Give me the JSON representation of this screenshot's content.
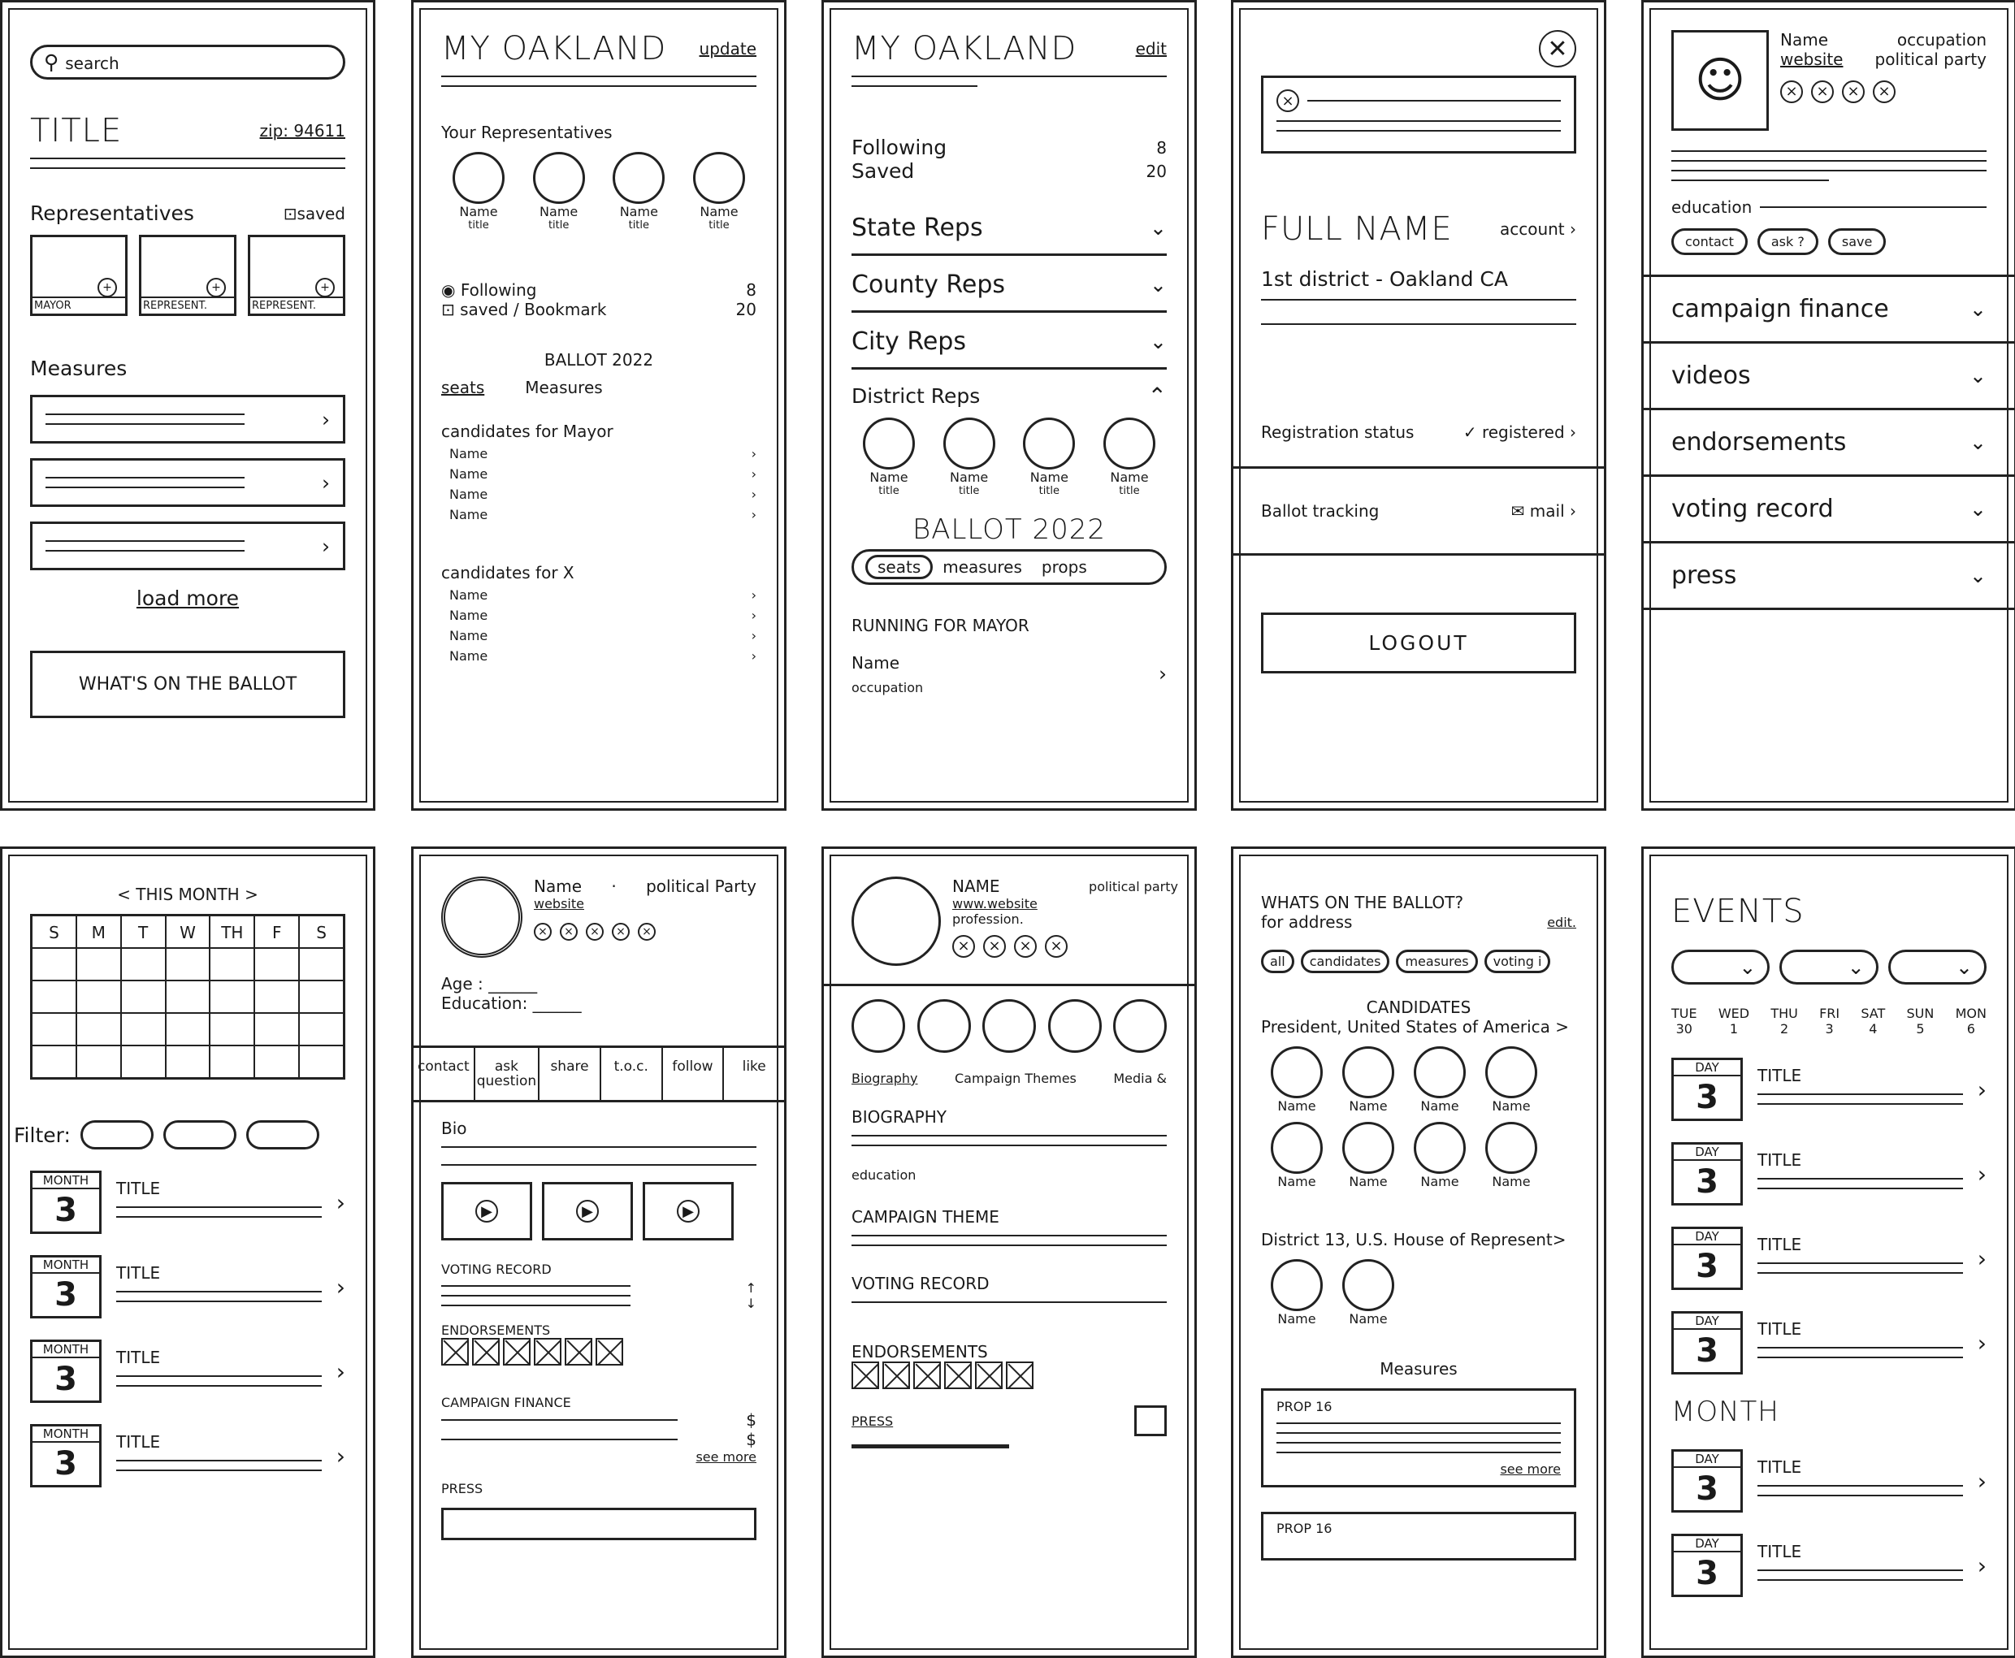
{
  "home": {
    "search_placeholder": "search",
    "title": "TITLE",
    "zip": "zip: 94611",
    "reps_heading": "Representatives",
    "saved": "saved",
    "rep_cards": [
      "MAYOR",
      "REPRESENT.",
      "REPRESENT."
    ],
    "measures_heading": "Measures",
    "load_more": "load more",
    "ballot_button": "WHAT'S ON THE BALLOT"
  },
  "my_oakland_a": {
    "title": "MY OAKLAND",
    "update": "update",
    "your_reps": "Your Representatives",
    "reps": [
      {
        "name": "Name",
        "title": "title"
      },
      {
        "name": "Name",
        "title": "title"
      },
      {
        "name": "Name",
        "title": "title"
      },
      {
        "name": "Name",
        "title": "title"
      }
    ],
    "following": "Following",
    "following_count": "8",
    "saved": "saved / Bookmark",
    "saved_count": "20",
    "ballot": "BALLOT 2022",
    "tabs": [
      "seats",
      "Measures"
    ],
    "groups": [
      {
        "heading": "candidates for Mayor",
        "names": [
          "Name",
          "Name",
          "Name",
          "Name"
        ]
      },
      {
        "heading": "candidates for X",
        "names": [
          "Name",
          "Name",
          "Name",
          "Name"
        ]
      }
    ]
  },
  "my_oakland_b": {
    "title": "MY OAKLAND",
    "edit": "edit",
    "following": "Following",
    "following_count": "8",
    "saved": "Saved",
    "saved_count": "20",
    "sections": [
      "State Reps",
      "County Reps",
      "City Reps"
    ],
    "district": "District Reps",
    "reps": [
      {
        "name": "Name",
        "title": "title"
      },
      {
        "name": "Name",
        "title": "title"
      },
      {
        "name": "Name",
        "title": "title"
      },
      {
        "name": "Name",
        "title": "title"
      }
    ],
    "ballot": "BALLOT 2022",
    "segments": [
      "seats",
      "measures",
      "props"
    ],
    "running": "RUNNING FOR MAYOR",
    "candidate_name": "Name",
    "candidate_occupation": "occupation"
  },
  "account": {
    "full_name": "FULL NAME",
    "account": "account",
    "district": "1st district - Oakland CA",
    "registration": "Registration status",
    "registered": "✓ registered",
    "ballot_tracking": "Ballot tracking",
    "mail": "mail",
    "logout": "LOGOUT"
  },
  "profile_a": {
    "name": "Name",
    "occupation": "occupation",
    "website": "website",
    "party": "political party",
    "education": "education",
    "buttons": [
      "contact",
      "ask ?",
      "save"
    ],
    "sections": [
      "campaign finance",
      "videos",
      "endorsements",
      "voting record",
      "press"
    ]
  },
  "calendar": {
    "month": "< THIS MONTH >",
    "days": [
      "S",
      "M",
      "T",
      "W",
      "TH",
      "F",
      "S"
    ],
    "filter": "Filter:",
    "events": [
      {
        "month": "MONTH",
        "day": "3",
        "title": "TITLE"
      },
      {
        "month": "MONTH",
        "day": "3",
        "title": "TITLE"
      },
      {
        "month": "MONTH",
        "day": "3",
        "title": "TITLE"
      },
      {
        "month": "MONTH",
        "day": "3",
        "title": "TITLE"
      }
    ]
  },
  "profile_b": {
    "name": "Name",
    "dot": "·",
    "party": "political Party",
    "website": "website",
    "age": "Age :",
    "education": "Education:",
    "actions": [
      "contact",
      "ask question",
      "share",
      "t.o.c.",
      "follow",
      "like"
    ],
    "bio": "Bio",
    "voting_record": "VOTING RECORD",
    "endorsements": "ENDORSEMENTS",
    "campaign_finance": "CAMPAIGN FINANCE",
    "dollar": "$",
    "see_more": "see more",
    "press": "PRESS"
  },
  "profile_c": {
    "name": "NAME",
    "website": "www.website",
    "profession": "profession.",
    "party": "political party",
    "tabs": [
      "Biography",
      "Campaign Themes",
      "Media &"
    ],
    "biography": "BIOGRAPHY",
    "education": "education",
    "campaign_theme": "CAMPAIGN THEME",
    "voting_record": "VOTING RECORD",
    "endorsements": "ENDORSEMENTS",
    "press": "PRESS"
  },
  "ballot": {
    "title": "WHATS ON THE BALLOT?",
    "for_address": "for address",
    "edit": "edit.",
    "chips": [
      "all",
      "candidates",
      "measures",
      "voting i"
    ],
    "candidates": "CANDIDATES",
    "race1": "President, United States of America >",
    "race1_names": [
      "Name",
      "Name",
      "Name",
      "Name",
      "Name",
      "Name",
      "Name",
      "Name"
    ],
    "race2": "District 13, U.S. House of Represent>",
    "race2_names": [
      "Name",
      "Name"
    ],
    "measures": "Measures",
    "props": [
      {
        "label": "PROP 16",
        "see_more": "see more"
      },
      {
        "label": "PROP 16"
      }
    ]
  },
  "events": {
    "title": "EVENTS",
    "week": [
      {
        "day": "TUE",
        "date": "30"
      },
      {
        "day": "WED",
        "date": "1"
      },
      {
        "day": "THU",
        "date": "2"
      },
      {
        "day": "FRI",
        "date": "3"
      },
      {
        "day": "SAT",
        "date": "4"
      },
      {
        "day": "SUN",
        "date": "5"
      },
      {
        "day": "MON",
        "date": "6"
      }
    ],
    "items": [
      {
        "label": "DAY",
        "day": "3",
        "title": "TITLE"
      },
      {
        "label": "DAY",
        "day": "3",
        "title": "TITLE"
      },
      {
        "label": "DAY",
        "day": "3",
        "title": "TITLE"
      },
      {
        "label": "DAY",
        "day": "3",
        "title": "TITLE"
      }
    ],
    "month": "MONTH",
    "month_items": [
      {
        "label": "DAY",
        "day": "3",
        "title": "TITLE"
      },
      {
        "label": "DAY",
        "day": "3",
        "title": "TITLE"
      }
    ]
  }
}
